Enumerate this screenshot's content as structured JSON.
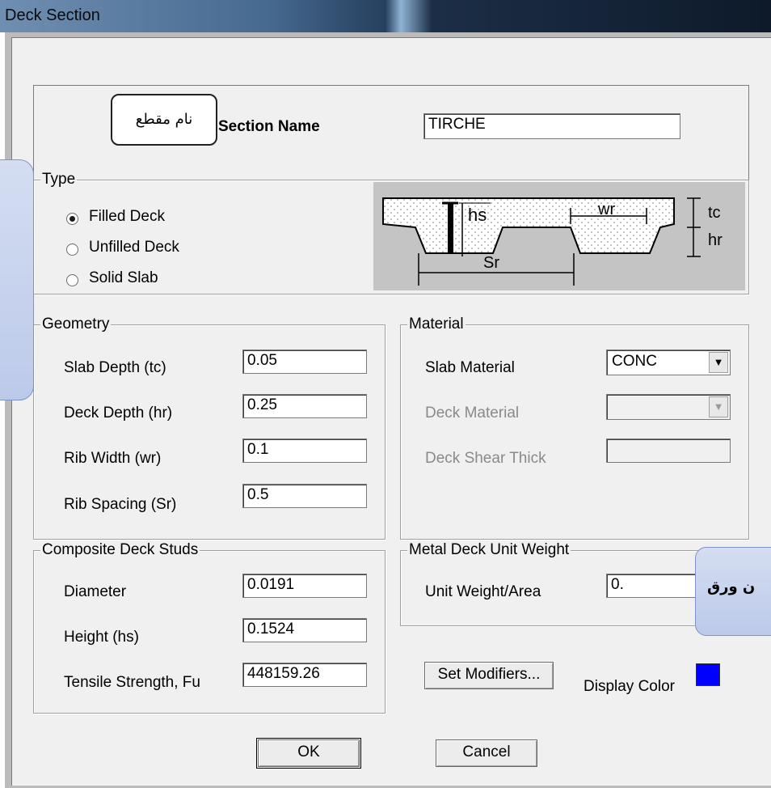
{
  "window": {
    "title": "Deck Section"
  },
  "section_name": {
    "label": "Section Name",
    "value": "TIRCHE",
    "callout": "نام مقطع"
  },
  "type": {
    "legend": "Type",
    "options": [
      {
        "label": "Filled Deck",
        "selected": true
      },
      {
        "label": "Unfilled Deck",
        "selected": false
      },
      {
        "label": "Solid Slab",
        "selected": false
      }
    ],
    "diagram": {
      "hs": "hs",
      "wr": "wr",
      "tc": "tc",
      "hr": "hr",
      "sr": "Sr"
    }
  },
  "geometry": {
    "legend": "Geometry",
    "fields": [
      {
        "label": "Slab Depth (tc)",
        "value": "0.05"
      },
      {
        "label": "Deck Depth (hr)",
        "value": "0.25"
      },
      {
        "label": "Rib Width (wr)",
        "value": "0.1"
      },
      {
        "label": "Rib Spacing (Sr)",
        "value": "0.5"
      }
    ]
  },
  "material": {
    "legend": "Material",
    "slab_material_label": "Slab Material",
    "slab_material_value": "CONC",
    "deck_material_label": "Deck Material",
    "deck_material_value": "",
    "deck_shear_label": "Deck Shear Thick",
    "deck_shear_value": ""
  },
  "studs": {
    "legend": "Composite Deck Studs",
    "fields": [
      {
        "label": "Diameter",
        "value": "0.0191"
      },
      {
        "label": "Height (hs)",
        "value": "0.1524"
      },
      {
        "label": "Tensile Strength, Fu",
        "value": "448159.26"
      }
    ]
  },
  "unit_weight": {
    "legend": "Metal Deck Unit Weight",
    "label": "Unit Weight/Area",
    "value": "0.",
    "overlay_text": "ن ورق"
  },
  "buttons": {
    "set_modifiers": "Set Modifiers...",
    "display_color_label": "Display Color",
    "display_color": "#0000ff",
    "ok": "OK",
    "cancel": "Cancel"
  }
}
